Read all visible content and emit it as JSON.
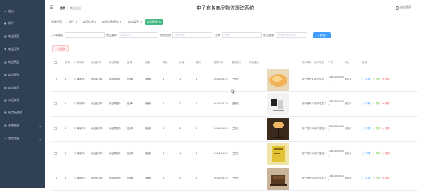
{
  "sidebar": {
    "items": [
      {
        "label": "首页",
        "icon": "home-icon"
      },
      {
        "label": "用户",
        "icon": "user-icon"
      },
      {
        "label": "商品信息",
        "icon": "grid-icon"
      },
      {
        "label": "商品订单",
        "icon": "order-icon"
      },
      {
        "label": "商品类型",
        "icon": "grid-icon"
      },
      {
        "label": "商品配送",
        "icon": "truck-icon"
      },
      {
        "label": "商品收货",
        "icon": "grid-icon"
      },
      {
        "label": "论坛交流",
        "icon": "grid-icon"
      },
      {
        "label": "留言板管理",
        "icon": "message-icon"
      },
      {
        "label": "系统管理",
        "icon": "settings-icon"
      },
      {
        "label": "我的信息",
        "icon": "profile-icon"
      }
    ]
  },
  "header": {
    "title": "电子商务商品物流跟踪系统",
    "breadcrumb_home": "首页",
    "breadcrumb_sep": "/",
    "breadcrumb_current": "商品配送",
    "logout": "退出登录"
  },
  "tags": [
    {
      "label": "系统首页",
      "active": false
    },
    {
      "label": "用户 ×",
      "active": false
    },
    {
      "label": "商品信息 ×",
      "active": false
    },
    {
      "label": "商品信息评论 ×",
      "active": false
    },
    {
      "label": "商品类型 ×",
      "active": false
    },
    {
      "label": "商品配送 ×",
      "active": true
    }
  ],
  "search": {
    "order_no_label": "订单编号",
    "goods_name_label": "商品名称",
    "goods_name_placeholder": "商品名称",
    "goods_type_label": "商品类型",
    "goods_type_placeholder": "商品类型",
    "brand_label": "品牌",
    "brand_placeholder": "品牌",
    "status_label": "是否签收",
    "status_placeholder": "请选择是否签收",
    "button": "搜索"
  },
  "batch_delete": "删除",
  "table": {
    "headers": [
      "",
      "序号",
      "订单编号",
      "商品名称",
      "商品类型",
      "品牌",
      "规格",
      "数量",
      "价格",
      "总价",
      "发货时间",
      "是否签收",
      "商品图片",
      "",
      "",
      "用户账号",
      "用户姓名",
      "手机",
      "地址",
      "操作"
    ],
    "rows": [
      {
        "index": "1",
        "order": "订单编号1",
        "name": "商品名称1",
        "type": "商品类型1",
        "brand": "品牌1",
        "spec": "规格1",
        "qty": "1",
        "price": "1",
        "total": "1",
        "time": "2024-03-02",
        "status": "已签收",
        "account": "用户账号1",
        "uname": "用户姓名1",
        "phone": "1381380000 1",
        "addr": "地址1"
      },
      {
        "index": "2",
        "order": "订单编号2",
        "name": "商品名称2",
        "type": "商品类型2",
        "brand": "品牌2",
        "spec": "规格2",
        "qty": "2",
        "price": "2",
        "total": "2",
        "time": "2024-03-02",
        "status": "已签收",
        "account": "用户账号2",
        "uname": "用户姓名2",
        "phone": "1381380000 2",
        "addr": "地址2"
      },
      {
        "index": "3",
        "order": "订单编号3",
        "name": "商品名称3",
        "type": "商品类型3",
        "brand": "品牌3",
        "spec": "规格3",
        "qty": "3",
        "price": "3",
        "total": "3",
        "time": "2024-03-02",
        "status": "已签收",
        "account": "用户账号3",
        "uname": "用户姓名3",
        "phone": "1381380000 3",
        "addr": "地址3"
      },
      {
        "index": "4",
        "order": "订单编号4",
        "name": "商品名称4",
        "type": "商品类型4",
        "brand": "品牌4",
        "spec": "规格4",
        "qty": "4",
        "price": "4",
        "total": "4",
        "time": "2024-03-02",
        "status": "已签收",
        "account": "用户账号4",
        "uname": "用户姓名4",
        "phone": "1381380000 4",
        "addr": "地址4"
      },
      {
        "index": "5",
        "order": "订单编号5",
        "name": "商品名称5",
        "type": "商品类型5",
        "brand": "品牌5",
        "spec": "规格5",
        "qty": "5",
        "price": "5",
        "total": "5",
        "time": "2024-03-02",
        "status": "已签收",
        "account": "用户账号5",
        "uname": "用户姓名5",
        "phone": "1381380000 5",
        "addr": "地址5"
      }
    ],
    "actions": {
      "detail": "详情",
      "edit": "修改",
      "delete": "删除"
    }
  },
  "colors": {
    "sidebar": "#304156",
    "primary": "#409eff",
    "active_tag": "#42b983",
    "danger": "#f56c6c",
    "success": "#67c23a"
  }
}
